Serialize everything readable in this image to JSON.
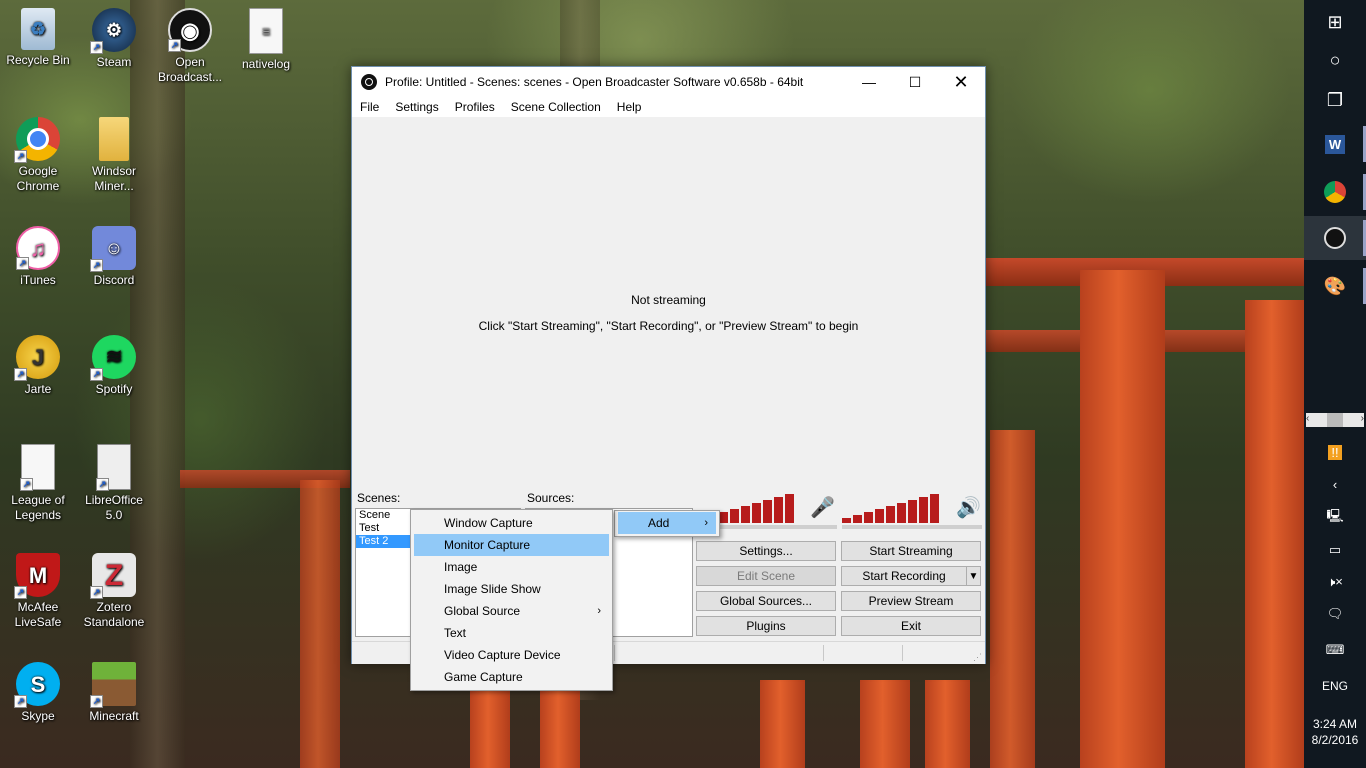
{
  "desktop": {
    "icons": [
      {
        "label": "Recycle Bin",
        "icon": "recycle-bin-icon",
        "color": "#8fb7d9"
      },
      {
        "label": "Steam",
        "icon": "steam-icon",
        "color": "#1b2838"
      },
      {
        "label": "Open Broadcast...",
        "icon": "obs-icon",
        "color": "#111111"
      },
      {
        "label": "nativelog",
        "icon": "document-icon",
        "color": "#f4f4f4"
      },
      {
        "label": "Google Chrome",
        "icon": "chrome-icon",
        "color": "#e84335"
      },
      {
        "label": "Windsor Miner...",
        "icon": "folder-icon",
        "color": "#e9c45a"
      },
      {
        "label": "iTunes",
        "icon": "itunes-icon",
        "color": "#ef5fa7"
      },
      {
        "label": "Discord",
        "icon": "discord-icon",
        "color": "#7289da"
      },
      {
        "label": "Jarte",
        "icon": "jarte-icon",
        "color": "#f3c01c"
      },
      {
        "label": "Spotify",
        "icon": "spotify-icon",
        "color": "#1ed760"
      },
      {
        "label": "League of Legends",
        "icon": "document-icon",
        "color": "#f4f4f4"
      },
      {
        "label": "LibreOffice 5.0",
        "icon": "document-icon",
        "color": "#e8e8e8"
      },
      {
        "label": "McAfee LiveSafe",
        "icon": "mcafee-icon",
        "color": "#c01818"
      },
      {
        "label": "Zotero Standalone",
        "icon": "zotero-icon",
        "color": "#cc2936"
      },
      {
        "label": "Skype",
        "icon": "skype-icon",
        "color": "#00aff0"
      },
      {
        "label": "Minecraft",
        "icon": "minecraft-icon",
        "color": "#5c8d2e"
      }
    ]
  },
  "window": {
    "title": "Profile: Untitled - Scenes: scenes - Open Broadcaster Software v0.658b - 64bit",
    "menu": [
      "File",
      "Settings",
      "Profiles",
      "Scene Collection",
      "Help"
    ],
    "preview": {
      "status": "Not streaming",
      "hint": "Click \"Start Streaming\", \"Start Recording\", or \"Preview Stream\" to begin"
    },
    "scenes_label": "Scenes:",
    "sources_label": "Sources:",
    "scenes": [
      "Scene",
      "Test",
      "Test 2"
    ],
    "selected_scene": "Test 2",
    "buttons": {
      "settings": "Settings...",
      "edit_scene": "Edit Scene",
      "global_sources": "Global Sources...",
      "plugins": "Plugins",
      "start_streaming": "Start Streaming",
      "start_recording": "Start Recording",
      "preview_stream": "Preview Stream",
      "exit": "Exit"
    },
    "meter_color": "#b71c1c"
  },
  "context_menu": {
    "add_label": "Add",
    "items": [
      "Window Capture",
      "Monitor Capture",
      "Image",
      "Image Slide Show",
      "Global Source",
      "Text",
      "Video Capture Device",
      "Game Capture"
    ],
    "highlighted": "Monitor Capture",
    "has_submenu": "Global Source"
  },
  "taskbar": {
    "language": "ENG",
    "time": "3:24 AM",
    "date": "8/2/2016"
  }
}
